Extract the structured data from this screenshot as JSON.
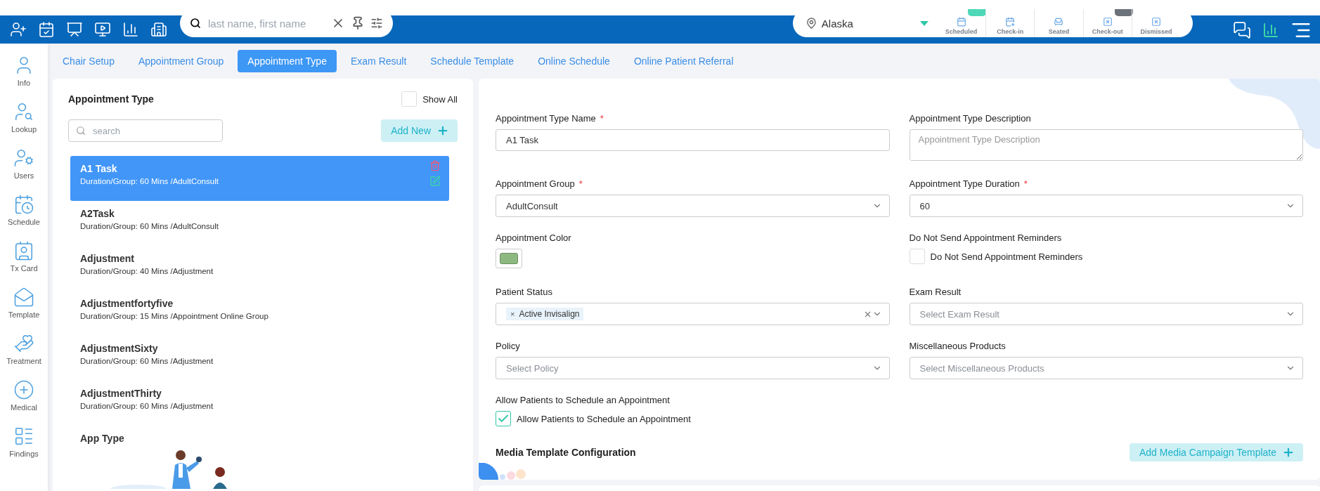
{
  "top_bar": {
    "search": {
      "placeholder": "last name, first name"
    },
    "location": "Alaska",
    "statuses": [
      {
        "label": "Scheduled",
        "kind": "scheduled",
        "color": "#4fd8b8"
      },
      {
        "label": "Check-in",
        "kind": "checkin"
      },
      {
        "label": "Seated",
        "kind": "seated"
      },
      {
        "label": "Check-out",
        "kind": "checkout",
        "color": "#6c7279"
      },
      {
        "label": "Dismissed",
        "kind": "dismissed"
      }
    ]
  },
  "sidebar": {
    "items": [
      {
        "label": "Info"
      },
      {
        "label": "Lookup"
      },
      {
        "label": "Users"
      },
      {
        "label": "Schedule"
      },
      {
        "label": "Tx Card"
      },
      {
        "label": "Template"
      },
      {
        "label": "Treatment"
      },
      {
        "label": "Medical"
      },
      {
        "label": "Findings"
      }
    ]
  },
  "tabs": [
    {
      "label": "Chair Setup",
      "selected": false
    },
    {
      "label": "Appointment Group",
      "selected": false
    },
    {
      "label": "Appointment Type",
      "selected": true
    },
    {
      "label": "Exam Result",
      "selected": false
    },
    {
      "label": "Schedule Template",
      "selected": false
    },
    {
      "label": "Online Schedule",
      "selected": false
    },
    {
      "label": "Online Patient Referral",
      "selected": false
    }
  ],
  "list_panel": {
    "title": "Appointment Type",
    "show_all": {
      "label": "Show All",
      "checked": false
    },
    "search": {
      "placeholder": "search"
    },
    "add_button": "Add New",
    "items": [
      {
        "name": "A1 Task",
        "detail": "Duration/Group: 60 Mins /AdultConsult",
        "selected": true
      },
      {
        "name": "A2Task",
        "detail": "Duration/Group: 60 Mins /AdultConsult",
        "selected": false
      },
      {
        "name": "Adjustment",
        "detail": "Duration/Group: 40 Mins /Adjustment",
        "selected": false
      },
      {
        "name": "Adjustmentfortyfive",
        "detail": "Duration/Group: 15 Mins /Appointment Online Group",
        "selected": false
      },
      {
        "name": "AdjustmentSixty",
        "detail": "Duration/Group: 60 Mins /Adjustment",
        "selected": false
      },
      {
        "name": "AdjustmentThirty",
        "detail": "Duration/Group: 60 Mins /Adjustment",
        "selected": false
      },
      {
        "name": "App Type",
        "selected": false
      }
    ]
  },
  "form": {
    "fields": [
      {
        "kind": "input",
        "label": "Appointment Type Name",
        "required_mark": "*",
        "value": "A1 Task"
      },
      {
        "kind": "textarea",
        "label": "Appointment Type Description",
        "placeholder": "Appointment Type Description"
      },
      {
        "kind": "select",
        "label": "Appointment Group",
        "required_mark": "*",
        "value": "AdultConsult"
      },
      {
        "kind": "select",
        "label": "Appointment Type Duration",
        "required_mark": "*",
        "value": "60"
      },
      {
        "kind": "color",
        "label": "Appointment Color",
        "color": "#8db87f"
      },
      {
        "kind": "checkbox",
        "label": "Do Not Send Appointment Reminders",
        "option": "Do Not Send Appointment Reminders",
        "checked": false
      },
      {
        "kind": "tags",
        "label": "Patient Status",
        "tags": [
          {
            "label": "Active Invisalign",
            "remove": "×"
          }
        ]
      },
      {
        "kind": "select",
        "label": "Exam Result",
        "placeholder": "Select Exam Result"
      },
      {
        "kind": "select",
        "label": "Policy",
        "placeholder": "Select Policy"
      },
      {
        "kind": "select",
        "label": "Miscellaneous Products",
        "placeholder": "Select Miscellaneous Products"
      },
      {
        "kind": "checkbox",
        "label": "Allow Patients to Schedule an Appointment",
        "option": "Allow Patients to Schedule an Appointment",
        "checked": true
      }
    ],
    "media": {
      "title": "Media Template Configuration",
      "button": "Add Media Campaign Template"
    }
  }
}
